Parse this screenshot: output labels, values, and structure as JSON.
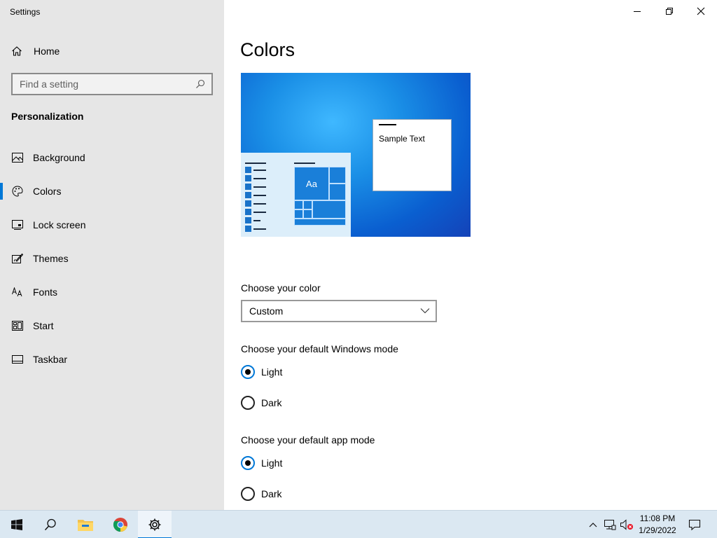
{
  "window": {
    "title": "Settings",
    "controls": {
      "minimize": "minimize",
      "maximize": "restore",
      "close": "close"
    }
  },
  "sidebar": {
    "home_label": "Home",
    "search": {
      "placeholder": "Find a setting"
    },
    "section_title": "Personalization",
    "items": [
      {
        "label": "Background",
        "icon": "picture-icon",
        "selected": false
      },
      {
        "label": "Colors",
        "icon": "palette-icon",
        "selected": true
      },
      {
        "label": "Lock screen",
        "icon": "lock-screen-icon",
        "selected": false
      },
      {
        "label": "Themes",
        "icon": "themes-icon",
        "selected": false
      },
      {
        "label": "Fonts",
        "icon": "fonts-icon",
        "selected": false
      },
      {
        "label": "Start",
        "icon": "start-icon",
        "selected": false
      },
      {
        "label": "Taskbar",
        "icon": "taskbar-icon",
        "selected": false
      }
    ]
  },
  "main": {
    "title": "Colors",
    "preview": {
      "sample_text": "Sample Text",
      "tile_text": "Aa"
    },
    "choose_color": {
      "label": "Choose your color",
      "selected": "Custom"
    },
    "windows_mode": {
      "label": "Choose your default Windows mode",
      "options": [
        "Light",
        "Dark"
      ],
      "selected": "Light"
    },
    "app_mode": {
      "label": "Choose your default app mode",
      "options": [
        "Light",
        "Dark"
      ],
      "selected": "Light"
    }
  },
  "taskbar": {
    "buttons": [
      "windows-start-icon",
      "search-icon",
      "file-explorer-icon",
      "chrome-icon",
      "settings-gear-icon"
    ],
    "tray": [
      "chevron-up-icon",
      "network-icon",
      "volume-muted-icon"
    ],
    "clock": {
      "time": "11:08 PM",
      "date": "1/29/2022"
    },
    "notification_icon": "action-center-icon"
  },
  "colors": {
    "accent": "#0078d7",
    "sidebar_bg": "#e6e6e6",
    "taskbar_bg": "#dbe8f2"
  }
}
